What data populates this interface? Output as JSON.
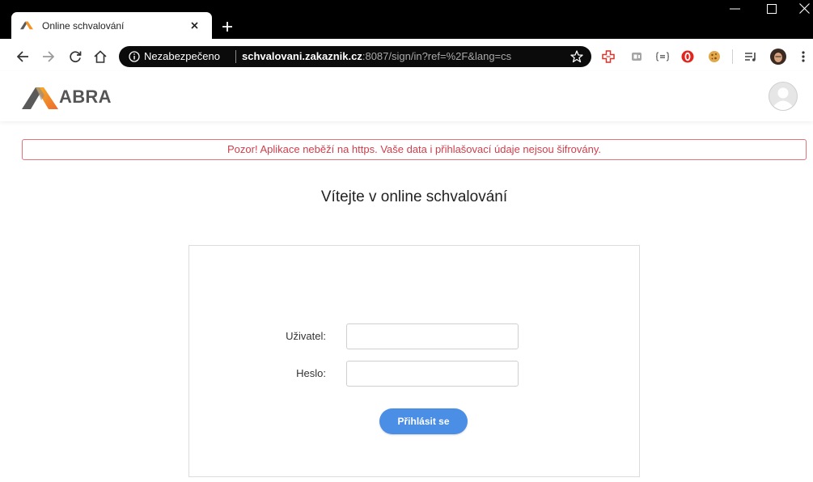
{
  "browser": {
    "tab": {
      "title": "Online schvalování",
      "favicon": "abra-logo-icon",
      "close_icon": "close-icon"
    },
    "new_tab_icon": "plus-icon",
    "window_controls": [
      "minimize-icon",
      "maximize-icon",
      "close-icon"
    ],
    "nav_icons": [
      "arrow-left-icon",
      "arrow-right-icon",
      "reload-icon",
      "home-icon"
    ],
    "address": {
      "security_icon": "info-icon",
      "security_label": "Nezabezpečeno",
      "host": "schvalovani.zakaznik.cz",
      "path": ":8087/sign/in?ref=%2F&lang=cs",
      "bookmark_icon": "star-icon"
    },
    "extensions": [
      "red-cross-extension-icon",
      "grey-extension-icon",
      "json-viewer-icon",
      "adblock-icon",
      "cookie-icon",
      "playlist-icon"
    ],
    "profile_icon": "profile-avatar-icon",
    "menu_icon": "more-vertical-icon"
  },
  "app": {
    "logo_text": "ABRA",
    "user_icon": "user-avatar-icon",
    "warning": "Pozor! Aplikace neběží na https. Vaše data i přihlašovací údaje nejsou šifrovány.",
    "heading": "Vítejte v online schvalování",
    "form": {
      "username_label": "Uživatel:",
      "username_value": "",
      "password_label": "Heslo:",
      "password_value": "",
      "submit_label": "Přihlásit se"
    }
  },
  "colors": {
    "chrome-frame": "#000000",
    "omnibox": "#0b0b0b",
    "warning-border": "#e2737c",
    "warning-text": "#cf3f4b",
    "button": "#4a8ee6",
    "logo-orange": "#f29322"
  }
}
